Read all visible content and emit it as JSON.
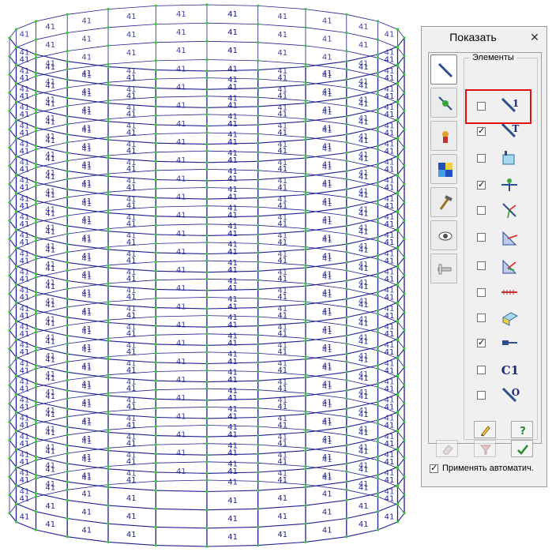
{
  "viewport": {
    "element_label": "41",
    "mesh_color": "#1f1f8f",
    "node_color": "#39c439"
  },
  "panel": {
    "title": "Показать",
    "close_glyph": "✕",
    "group_label": "Элементы",
    "tabs": [
      {
        "name": "elements-tab-icon",
        "active": true
      },
      {
        "name": "nodes-tab-icon",
        "active": false
      },
      {
        "name": "loads-tab-icon",
        "active": false
      },
      {
        "name": "color-map-tab-icon",
        "active": false
      },
      {
        "name": "tools-tab-icon",
        "active": false
      },
      {
        "name": "visibility-tab-icon",
        "active": false
      },
      {
        "name": "slider-tab-icon",
        "active": false
      }
    ],
    "options": [
      {
        "icon": "element-number-icon",
        "icon_text": "1",
        "checked": false
      },
      {
        "icon": "element-type-icon",
        "icon_text": "T",
        "checked": true
      },
      {
        "icon": "element-stiffness-icon",
        "icon_text": "",
        "checked": false
      },
      {
        "icon": "hinge-icon",
        "icon_text": "",
        "checked": true
      },
      {
        "icon": "local-axes-icon",
        "icon_text": "",
        "checked": false
      },
      {
        "icon": "plate-normal-icon",
        "icon_text": "",
        "checked": false
      },
      {
        "icon": "plate-axes-icon",
        "icon_text": "",
        "checked": false
      },
      {
        "icon": "fe-mesh-division-icon",
        "icon_text": "",
        "checked": false
      },
      {
        "icon": "section-3d-icon",
        "icon_text": "",
        "checked": false
      },
      {
        "icon": "rigid-link-icon",
        "icon_text": "",
        "checked": true
      },
      {
        "icon": "construction-element-icon",
        "icon_text": "C1",
        "checked": false
      },
      {
        "icon": "element-orientation-icon",
        "icon_text": "O",
        "checked": false
      }
    ],
    "check_glyph": "✓",
    "apply_auto_label": "Применять автоматич.",
    "apply_auto_checked": true,
    "highlight_color": "#e01010"
  }
}
